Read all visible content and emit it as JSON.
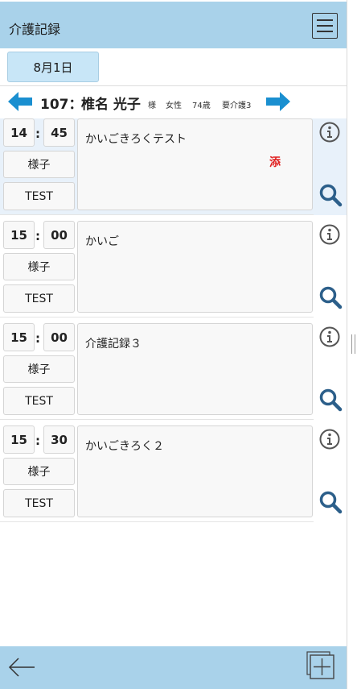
{
  "header": {
    "title": "介護記録",
    "menu_icon": "hamburger-menu-icon"
  },
  "date": {
    "label": "8月1日"
  },
  "resident": {
    "prev_icon": "arrow-left-icon",
    "next_icon": "arrow-right-icon",
    "id": "107：",
    "name": "椎名 光子",
    "honorific": "様",
    "gender": "女性",
    "age": "74歳",
    "care_level": "要介護3"
  },
  "records": [
    {
      "hour": "14",
      "colon": ":",
      "minute": "45",
      "category": "様子",
      "staff": "TEST",
      "content": "かいごきろくテスト",
      "attachment": "添",
      "active": true
    },
    {
      "hour": "15",
      "colon": ":",
      "minute": "00",
      "category": "様子",
      "staff": "TEST",
      "content": "かいご",
      "attachment": "",
      "active": false
    },
    {
      "hour": "15",
      "colon": ":",
      "minute": "00",
      "category": "様子",
      "staff": "TEST",
      "content": "介護記録３",
      "attachment": "",
      "active": false
    },
    {
      "hour": "15",
      "colon": ":",
      "minute": "30",
      "category": "様子",
      "staff": "TEST",
      "content": "かいごきろく２",
      "attachment": "",
      "active": false
    }
  ],
  "footer": {
    "back_icon": "back-arrow-icon",
    "add_icon": "add-record-icon"
  },
  "colors": {
    "header_bg": "#a9d2ea",
    "date_chip": "#c8e6f7",
    "arrow": "#1a8fd0",
    "search_icon": "#2c5f8a",
    "attachment": "#e02020"
  }
}
